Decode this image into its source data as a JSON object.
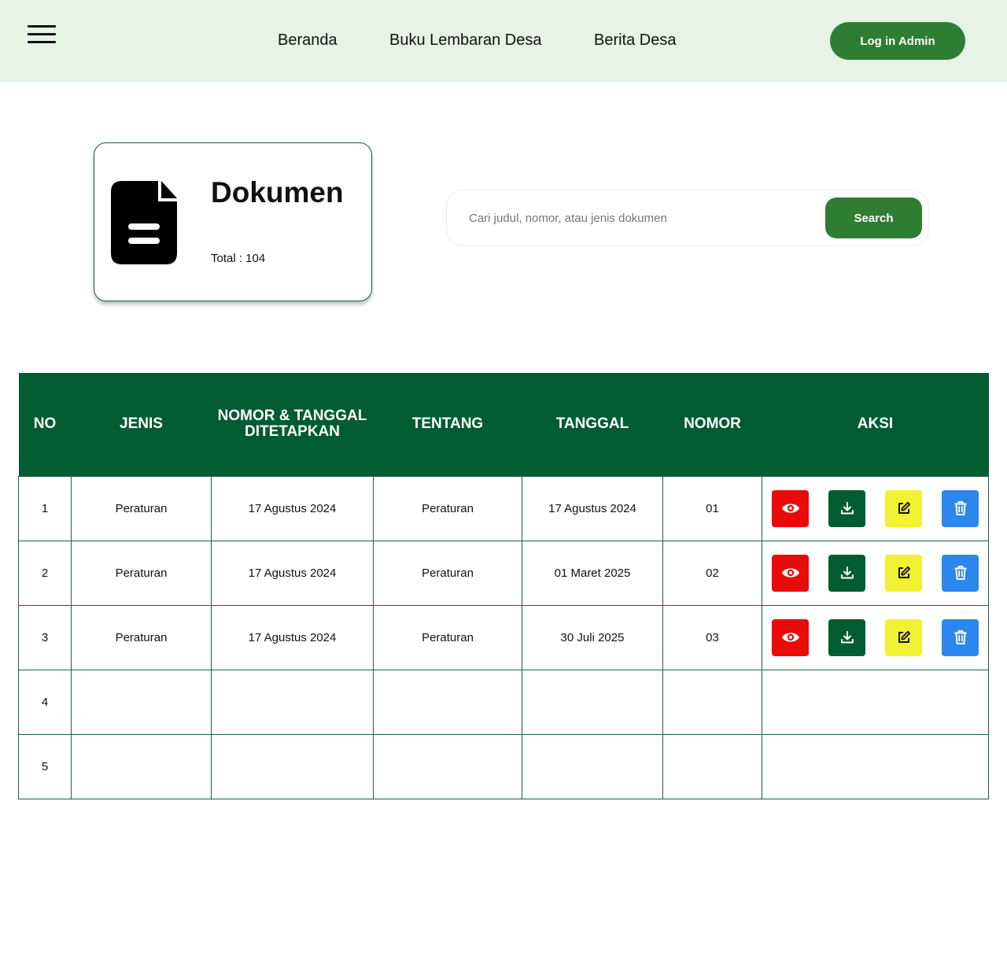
{
  "header": {
    "nav": [
      "Beranda",
      "Buku Lembaran Desa",
      "Berita Desa"
    ],
    "login_label": "Log in Admin"
  },
  "summary": {
    "title": "Dokumen",
    "total": "Total : 104"
  },
  "search": {
    "placeholder": "Cari judul, nomor, atau jenis dokumen",
    "button_label": "Search"
  },
  "table": {
    "columns": [
      "NO",
      "JENIS",
      "NOMOR & TANGGAL DITETAPKAN",
      "TENTANG",
      "TANGGAL",
      "NOMOR",
      "AKSI"
    ],
    "rows": [
      {
        "no": "1",
        "jenis": "Peraturan",
        "nomor_tanggal": "17 Agustus 2024",
        "tentang": "Peraturan",
        "tanggal": "17 Agustus 2024",
        "nomor": "01"
      },
      {
        "no": "2",
        "jenis": "Peraturan",
        "nomor_tanggal": "17 Agustus 2024",
        "tentang": "Peraturan",
        "tanggal": "01 Maret 2025",
        "nomor": "02"
      },
      {
        "no": "3",
        "jenis": "Peraturan",
        "nomor_tanggal": "17 Agustus 2024",
        "tentang": "Peraturan",
        "tanggal": "30 Juli 2025",
        "nomor": "03"
      },
      {
        "no": "4",
        "jenis": "",
        "nomor_tanggal": "",
        "tentang": "",
        "tanggal": "",
        "nomor": ""
      },
      {
        "no": "5",
        "jenis": "",
        "nomor_tanggal": "",
        "tentang": "",
        "tanggal": "",
        "nomor": ""
      }
    ],
    "actions": [
      {
        "icon": "eye-icon",
        "color": "#ea0a0a"
      },
      {
        "icon": "download-icon",
        "color": "#025c31"
      },
      {
        "icon": "edit-icon",
        "color": "#f1f233"
      },
      {
        "icon": "trash-icon",
        "color": "#2b86ee"
      }
    ]
  },
  "colors": {
    "header_bg": "#e6f3e5",
    "primary_green": "#2e7d32",
    "table_header_bg": "#025c31",
    "border": "#1e5e3e"
  }
}
